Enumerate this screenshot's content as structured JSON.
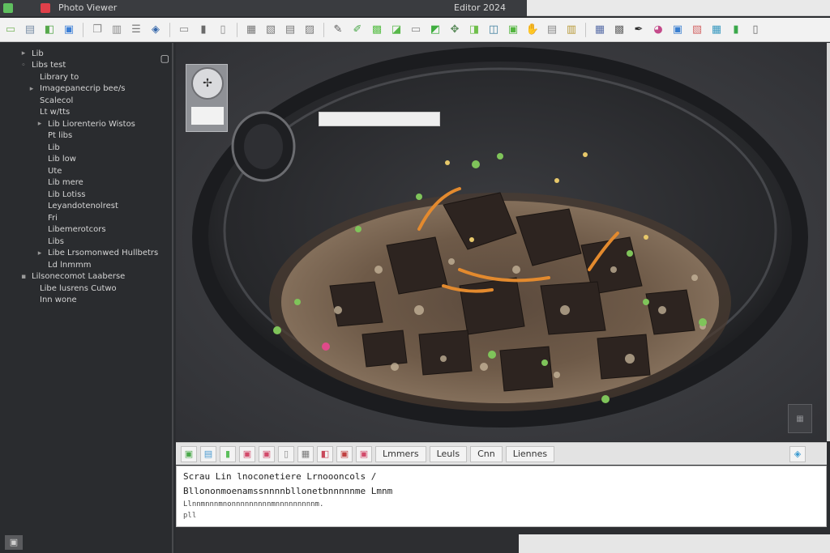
{
  "window": {
    "title": "Photo Viewer",
    "status_right": "Editor 2024"
  },
  "toolbar": {
    "icons": [
      {
        "name": "new-file-icon",
        "glyph": "▭",
        "color": "#7bb661"
      },
      {
        "name": "open-folder-icon",
        "glyph": "▤",
        "color": "#7a8ea6"
      },
      {
        "name": "save-icon",
        "glyph": "◧",
        "color": "#56a84b"
      },
      {
        "name": "save-as-icon",
        "glyph": "▣",
        "color": "#3c7fd6"
      },
      {
        "name": "sep",
        "glyph": "",
        "color": ""
      },
      {
        "name": "copy-icon",
        "glyph": "❐",
        "color": "#8a8a8a"
      },
      {
        "name": "paste-icon",
        "glyph": "▥",
        "color": "#8a8a8a"
      },
      {
        "name": "list-icon",
        "glyph": "☰",
        "color": "#7a7a7a"
      },
      {
        "name": "properties-icon",
        "glyph": "◈",
        "color": "#3366aa"
      },
      {
        "name": "sep",
        "glyph": "",
        "color": ""
      },
      {
        "name": "cut-icon",
        "glyph": "▭",
        "color": "#8a8a8a"
      },
      {
        "name": "lock-icon",
        "glyph": "▮",
        "color": "#6a6a6a"
      },
      {
        "name": "clip-icon",
        "glyph": "▯",
        "color": "#8a8a8a"
      },
      {
        "name": "sep",
        "glyph": "",
        "color": ""
      },
      {
        "name": "grid-icon",
        "glyph": "▦",
        "color": "#7a7a7a"
      },
      {
        "name": "frame-icon",
        "glyph": "▧",
        "color": "#7a7a7a"
      },
      {
        "name": "layers-icon",
        "glyph": "▤",
        "color": "#7a7a7a"
      },
      {
        "name": "image-icon",
        "glyph": "▨",
        "color": "#7a7a7a"
      },
      {
        "name": "sep",
        "glyph": "",
        "color": ""
      },
      {
        "name": "pencil-icon",
        "glyph": "✎",
        "color": "#5a5a5a"
      },
      {
        "name": "brush-icon",
        "glyph": "✐",
        "color": "#4aa84a"
      },
      {
        "name": "fill-icon",
        "glyph": "▩",
        "color": "#5bbf4a"
      },
      {
        "name": "crop-icon",
        "glyph": "◪",
        "color": "#58b84a"
      },
      {
        "name": "rect-select-icon",
        "glyph": "▭",
        "color": "#8a8a8a"
      },
      {
        "name": "lasso-icon",
        "glyph": "◩",
        "color": "#3fae3f"
      },
      {
        "name": "move-icon",
        "glyph": "✥",
        "color": "#5a8a5a"
      },
      {
        "name": "rotate-icon",
        "glyph": "◨",
        "color": "#6fbf4a"
      },
      {
        "name": "flip-icon",
        "glyph": "◫",
        "color": "#3f7f9f"
      },
      {
        "name": "zoom-icon",
        "glyph": "▣",
        "color": "#53b53f"
      },
      {
        "name": "hand-icon",
        "glyph": "✋",
        "color": "#4aa84a"
      },
      {
        "name": "text-icon",
        "glyph": "▤",
        "color": "#8a8a8a"
      },
      {
        "name": "shape-icon",
        "glyph": "▥",
        "color": "#b89a3a"
      },
      {
        "name": "sep",
        "glyph": "",
        "color": ""
      },
      {
        "name": "filter-icon",
        "glyph": "▦",
        "color": "#5a6fa8"
      },
      {
        "name": "adjust-icon",
        "glyph": "▩",
        "color": "#6a6a6a"
      },
      {
        "name": "eyedropper-icon",
        "glyph": "✒",
        "color": "#2a2a2a"
      },
      {
        "name": "palette-icon",
        "glyph": "◕",
        "color": "#c44a8a"
      },
      {
        "name": "effects-icon",
        "glyph": "▣",
        "color": "#3a7fd0"
      },
      {
        "name": "histogram-icon",
        "glyph": "▧",
        "color": "#d46a6a"
      },
      {
        "name": "levels-icon",
        "glyph": "▦",
        "color": "#3a9ac0"
      },
      {
        "name": "chart-icon",
        "glyph": "▮",
        "color": "#3aa84a"
      },
      {
        "name": "info-icon",
        "glyph": "▯",
        "color": "#6a6a6a"
      }
    ]
  },
  "sidebar": {
    "items": [
      {
        "label": "Lib",
        "indent": 0,
        "twisty": "▸"
      },
      {
        "label": "Libs test",
        "indent": 0,
        "twisty": "◦"
      },
      {
        "label": "Library to",
        "indent": 1,
        "twisty": ""
      },
      {
        "label": "Imagepanecrip bee/s",
        "indent": 1,
        "twisty": "▸"
      },
      {
        "label": "Scalecol",
        "indent": 1,
        "twisty": ""
      },
      {
        "label": "Lt w/tts",
        "indent": 1,
        "twisty": ""
      },
      {
        "label": "Lib Liorenterio  Wistos",
        "indent": 2,
        "twisty": "▸"
      },
      {
        "label": "Pt  libs",
        "indent": 2,
        "twisty": ""
      },
      {
        "label": "Lib",
        "indent": 2,
        "twisty": ""
      },
      {
        "label": "Lib  low",
        "indent": 2,
        "twisty": ""
      },
      {
        "label": "Ute",
        "indent": 2,
        "twisty": ""
      },
      {
        "label": "Lib  mere",
        "indent": 2,
        "twisty": ""
      },
      {
        "label": "Lib  Lotiss",
        "indent": 2,
        "twisty": ""
      },
      {
        "label": "Leyandotenolrest",
        "indent": 2,
        "twisty": ""
      },
      {
        "label": "Fri",
        "indent": 2,
        "twisty": ""
      },
      {
        "label": "Libemerotcors",
        "indent": 2,
        "twisty": ""
      },
      {
        "label": "Libs",
        "indent": 2,
        "twisty": ""
      },
      {
        "label": "Libe Lrsomonwed  Hullbetrs",
        "indent": 2,
        "twisty": "▸"
      },
      {
        "label": "Ld  lnmmm",
        "indent": 2,
        "twisty": ""
      },
      {
        "label": "Lilsonecomot  Laaberse",
        "indent": 0,
        "twisty": "▪"
      },
      {
        "label": "Libe  lusrens  Cutwo",
        "indent": 1,
        "twisty": ""
      },
      {
        "label": "Inn  wone",
        "indent": 1,
        "twisty": ""
      }
    ]
  },
  "bottom_tabs": {
    "tabs": [
      {
        "name": "tab-image",
        "text": "▣",
        "type": "icon",
        "color": "#4aa84a"
      },
      {
        "name": "tab-levels",
        "text": "▤",
        "type": "icon",
        "color": "#4a9ad0"
      },
      {
        "name": "tab-green",
        "text": "▮",
        "type": "icon",
        "color": "#5cbf5c"
      },
      {
        "name": "tab-red-1",
        "text": "▣",
        "type": "icon",
        "color": "#d24a6a"
      },
      {
        "name": "tab-red-2",
        "text": "▣",
        "type": "icon",
        "color": "#d24a6a"
      },
      {
        "name": "tab-doc",
        "text": "▯",
        "type": "icon",
        "color": "#8a8a8a"
      },
      {
        "name": "tab-grid",
        "text": "▦",
        "type": "icon",
        "color": "#7a7a7a"
      },
      {
        "name": "tab-flag",
        "text": "◧",
        "type": "icon",
        "color": "#c8485a"
      },
      {
        "name": "tab-camera",
        "text": "▣",
        "type": "icon",
        "color": "#c04040"
      },
      {
        "name": "tab-alert",
        "text": "▣",
        "type": "icon",
        "color": "#d24a6a"
      },
      {
        "name": "tab-history",
        "text": "Lmmers",
        "type": "text",
        "color": "#333333"
      },
      {
        "name": "tab-layers",
        "text": "Leuls",
        "type": "text",
        "color": "#333333"
      },
      {
        "name": "tab-info",
        "text": "Cnn",
        "type": "text",
        "color": "#333333"
      },
      {
        "name": "tab-meta",
        "text": "Liennes",
        "type": "text",
        "color": "#333333"
      }
    ],
    "right_icon": {
      "text": "◈",
      "color": "#3a9ad0"
    }
  },
  "console": {
    "line1": "Scrau  Lin lnoconetiere  Lrnoooncols  /",
    "line2": "Bllononmoenamssnnnnbllonetbnnnnnme  Lmnm",
    "line3": "Llnnmnnnmnonnnnnnnnnmnnnnnnnnnm.",
    "prompt": "pll"
  }
}
